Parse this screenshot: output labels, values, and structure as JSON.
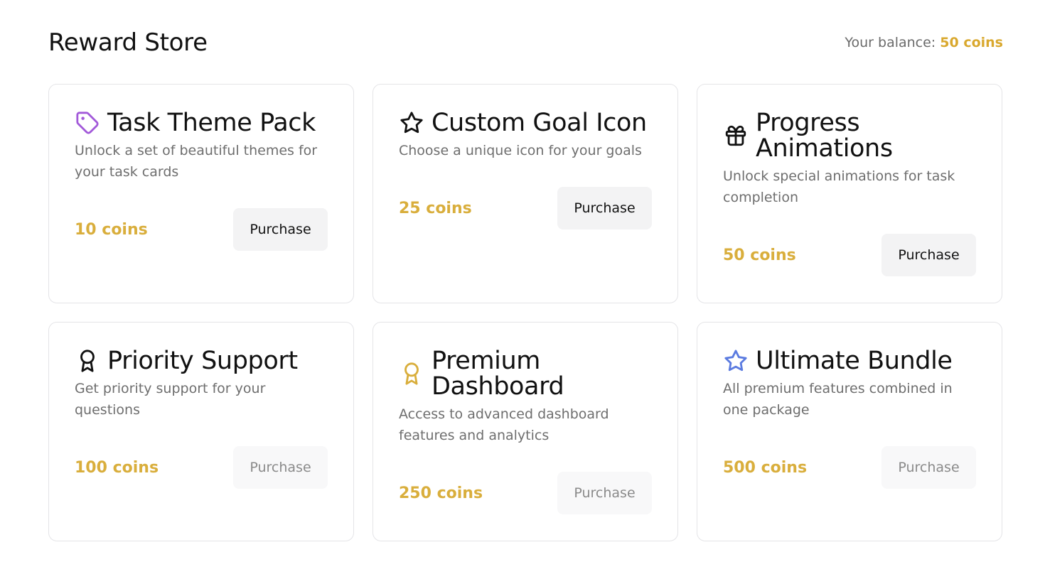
{
  "page": {
    "title": "Reward Store",
    "balance_label": "Your balance:",
    "balance_value": "50 coins"
  },
  "rewards": [
    {
      "title": "Task Theme Pack",
      "description": "Unlock a set of beautiful themes for your task cards",
      "price": "10 coins",
      "button": "Purchase",
      "icon": "tag-icon",
      "icon_color": "#a259d9",
      "affordable": true
    },
    {
      "title": "Custom Goal Icon",
      "description": "Choose a unique icon for your goals",
      "price": "25 coins",
      "button": "Purchase",
      "icon": "star-icon",
      "icon_color": "#111111",
      "affordable": true
    },
    {
      "title": "Progress Animations",
      "description": "Unlock special animations for task completion",
      "price": "50 coins",
      "button": "Purchase",
      "icon": "gift-icon",
      "icon_color": "#111111",
      "affordable": true
    },
    {
      "title": "Priority Support",
      "description": "Get priority support for your questions",
      "price": "100 coins",
      "button": "Purchase",
      "icon": "award-icon",
      "icon_color": "#111111",
      "affordable": false
    },
    {
      "title": "Premium Dashboard",
      "description": "Access to advanced dashboard features and analytics",
      "price": "250 coins",
      "button": "Purchase",
      "icon": "award-icon",
      "icon_color": "#d9ae3c",
      "affordable": false
    },
    {
      "title": "Ultimate Bundle",
      "description": "All premium features combined in one package",
      "price": "500 coins",
      "button": "Purchase",
      "icon": "star-icon",
      "icon_color": "#5b7be0",
      "affordable": false
    }
  ],
  "colors": {
    "accent_coins": "#d9ae3c",
    "card_border": "#e4e4e7",
    "button_bg": "#f3f3f4"
  }
}
